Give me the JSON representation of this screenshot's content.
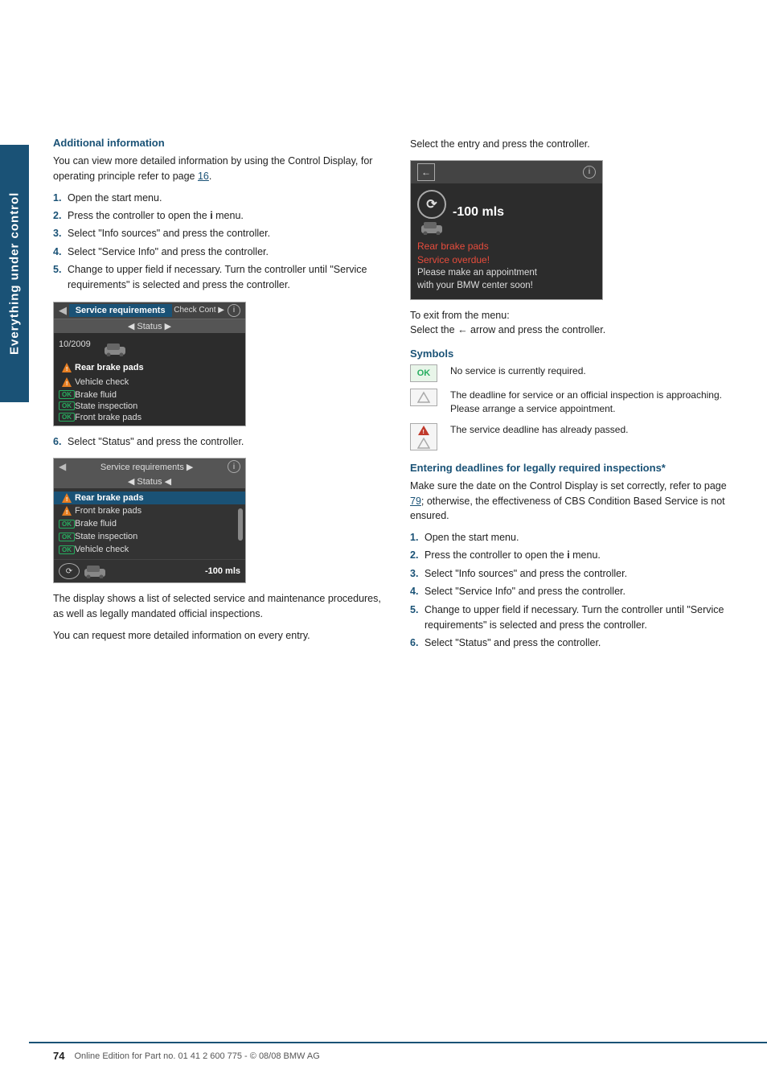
{
  "sidebar": {
    "label": "Everything under control"
  },
  "page": {
    "number": "74",
    "footer": "Online Edition for Part no. 01 41 2 600 775 - © 08/08 BMW AG"
  },
  "left": {
    "section1_heading": "Additional information",
    "section1_body1": "You can view more detailed information by using the Control Display, for operating principle refer to page 16.",
    "section1_steps": [
      {
        "num": "1.",
        "text": "Open the start menu."
      },
      {
        "num": "2.",
        "text": "Press the controller to open the i menu."
      },
      {
        "num": "3.",
        "text": "Select \"Info sources\" and press the controller."
      },
      {
        "num": "4.",
        "text": "Select \"Service Info\" and press the controller."
      },
      {
        "num": "5.",
        "text": "Change to upper field if necessary. Turn the controller until \"Service requirements\" is selected and press the controller."
      }
    ],
    "screen1": {
      "tab": "Service requirements",
      "header_right": "Check Cont ▶",
      "status_row": "◀ Status ▶",
      "date": "10/2009",
      "rows": [
        {
          "icon": "warn",
          "label": "Rear brake pads"
        },
        {
          "icon": "warn",
          "label": "Vehicle check"
        },
        {
          "icon": "ok",
          "label": "Brake fluid"
        },
        {
          "icon": "ok",
          "label": "State inspection"
        },
        {
          "icon": "ok",
          "label": "Front brake pads"
        }
      ]
    },
    "step6": {
      "num": "6.",
      "text": "Select \"Status\" and press the controller."
    },
    "screen2": {
      "header": "Service requirements ▶",
      "status_row": "◀ Status ◀",
      "rows": [
        {
          "icon": "warn",
          "label": "Rear brake pads",
          "selected": true
        },
        {
          "icon": "warn",
          "label": "Front brake pads",
          "selected": false
        },
        {
          "icon": "ok",
          "label": "Brake fluid",
          "selected": false
        },
        {
          "icon": "ok",
          "label": "State inspection",
          "selected": false
        },
        {
          "icon": "ok",
          "label": "Vehicle check",
          "selected": false
        }
      ],
      "mls": "-100 mls"
    },
    "body2": "The display shows a list of selected service and maintenance procedures, as well as legally mandated official inspections.",
    "body3": "You can request more detailed information on every entry."
  },
  "right": {
    "intro": "Select the entry and press the controller.",
    "info_screen": {
      "mls": "-100 mls",
      "service_label": "Rear brake pads",
      "overdue_label": "Service overdue!",
      "line3": "Please make an appointment",
      "line4": "with your BMW center soon!"
    },
    "exit_note": "To exit from the menu:",
    "exit_detail": "Select the ← arrow and press the controller.",
    "symbols_heading": "Symbols",
    "symbols": [
      {
        "icon_type": "ok",
        "icon_label": "OK",
        "text": "No service is currently required."
      },
      {
        "icon_type": "tri_outline",
        "icon_label": "△",
        "text": "The deadline for service or an official inspection is approaching. Please arrange a service appointment."
      },
      {
        "icon_type": "tri_red",
        "icon_label": "△",
        "text": "The service deadline has already passed."
      }
    ],
    "section2_heading": "Entering deadlines for legally required inspections*",
    "section2_body1": "Make sure the date on the Control Display is set correctly, refer to page 79; otherwise, the effectiveness of CBS Condition Based Service is not ensured.",
    "section2_steps": [
      {
        "num": "1.",
        "text": "Open the start menu."
      },
      {
        "num": "2.",
        "text": "Press the controller to open the i menu."
      },
      {
        "num": "3.",
        "text": "Select \"Info sources\" and press the controller."
      },
      {
        "num": "4.",
        "text": "Select \"Service Info\" and press the controller."
      },
      {
        "num": "5.",
        "text": "Change to upper field if necessary. Turn the controller until \"Service requirements\" is selected and press the controller."
      },
      {
        "num": "6.",
        "text": "Select \"Status\" and press the controller."
      }
    ]
  }
}
